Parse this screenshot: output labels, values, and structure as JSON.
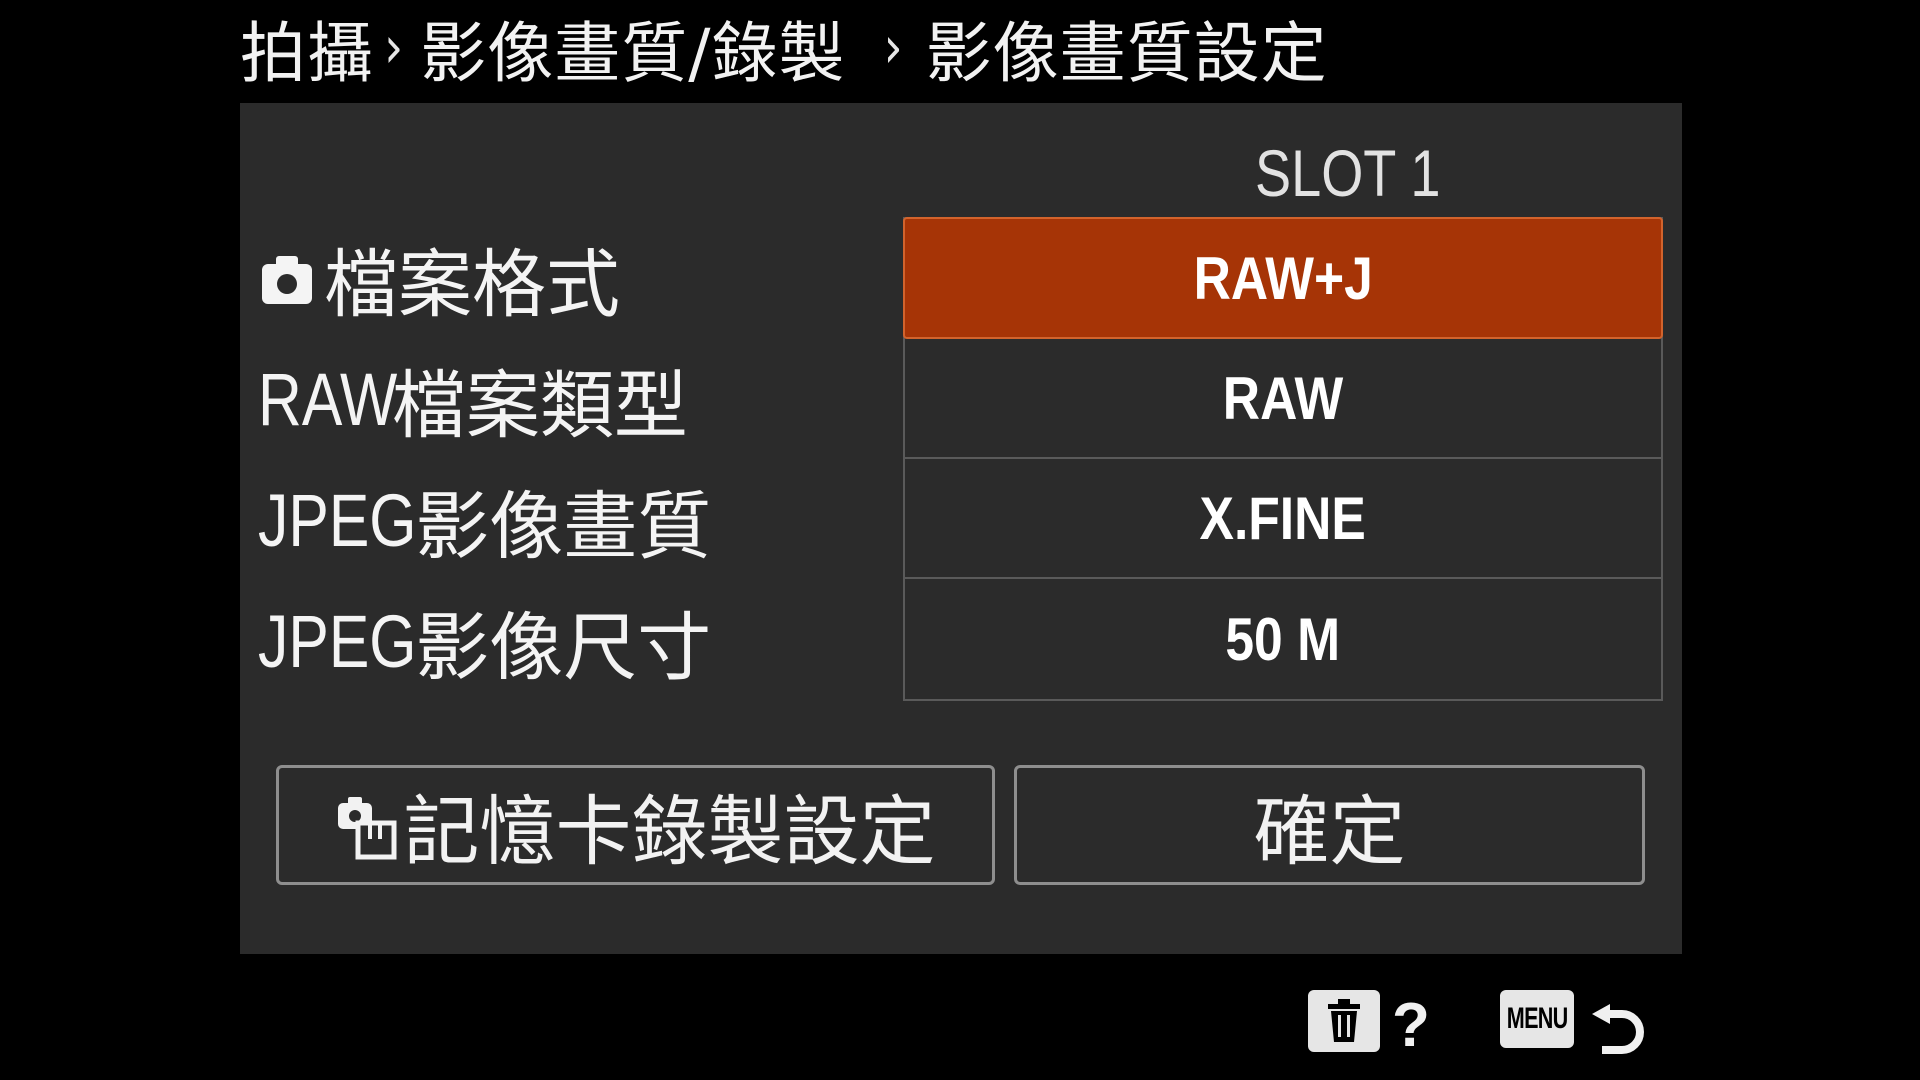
{
  "breadcrumb": {
    "level1": "拍攝",
    "level2": "影像畫質/錄製",
    "level3": "影像畫質設定",
    "separator": "›"
  },
  "slot": {
    "title": "SLOT 1"
  },
  "settings": [
    {
      "label_latin": "",
      "label_cjk": "檔案格式",
      "value": "RAW+J",
      "icon": "camera-icon",
      "selected": true
    },
    {
      "label_latin": "RAW",
      "label_cjk": "檔案類型",
      "value": "RAW",
      "selected": false
    },
    {
      "label_latin": "JPEG",
      "label_cjk": "影像畫質",
      "value": "X.FINE",
      "selected": false
    },
    {
      "label_latin": "JPEG",
      "label_cjk": "影像尺寸",
      "value": "50 M",
      "selected": false
    }
  ],
  "buttons": {
    "card_settings": "記憶卡錄製設定",
    "confirm": "確定"
  },
  "footer": {
    "help": "?",
    "menu": "MENU"
  },
  "colors": {
    "selected_bg": "#a63406",
    "panel_bg": "#2b2b2b",
    "background": "#000000"
  }
}
